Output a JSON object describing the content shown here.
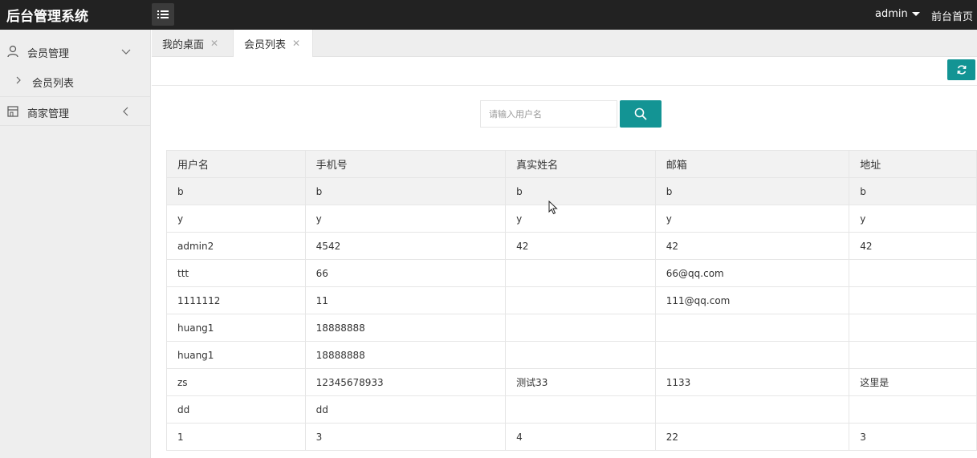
{
  "header": {
    "logo": "后台管理系统",
    "user": "admin",
    "home_link": "前台首页"
  },
  "sidebar": {
    "items": [
      {
        "label": "会员管理",
        "icon": "user-icon",
        "expanded": true
      },
      {
        "label": "会员列表",
        "icon": "chevron-right-icon"
      },
      {
        "label": "商家管理",
        "icon": "store-icon",
        "expanded": false
      }
    ]
  },
  "tabs": [
    {
      "label": "我的桌面",
      "active": false
    },
    {
      "label": "会员列表",
      "active": true
    }
  ],
  "search": {
    "placeholder": "请输入用户名"
  },
  "table": {
    "columns": [
      "用户名",
      "手机号",
      "真实姓名",
      "邮箱",
      "地址"
    ],
    "rows": [
      [
        "b",
        "b",
        "b",
        "b",
        "b"
      ],
      [
        "y",
        "y",
        "y",
        "y",
        "y"
      ],
      [
        "admin2",
        "4542",
        "42",
        "42",
        "42"
      ],
      [
        "ttt",
        "66",
        "",
        "66@qq.com",
        ""
      ],
      [
        "1111112",
        "11",
        "",
        "111@qq.com",
        ""
      ],
      [
        "huang1",
        "18888888",
        "",
        "",
        ""
      ],
      [
        "huang1",
        "18888888",
        "",
        "",
        ""
      ],
      [
        "zs",
        "12345678933",
        "测试33",
        "1133",
        "这里是"
      ],
      [
        "dd",
        "dd",
        "",
        "",
        ""
      ],
      [
        "1",
        "3",
        "4",
        "22",
        "3"
      ]
    ]
  },
  "colors": {
    "header_bg": "#222222",
    "accent": "#139494",
    "sidebar_bg": "#eeeeee"
  }
}
